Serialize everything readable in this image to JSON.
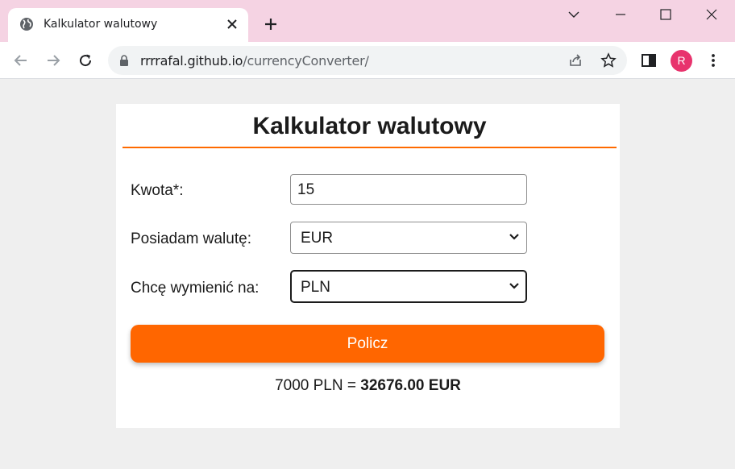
{
  "browser": {
    "tab_title": "Kalkulator walutowy",
    "url_host": "rrrrafal.github.io",
    "url_path": "/currencyConverter/",
    "profile_initial": "R",
    "accent_colors": {
      "titlebar": "#f5d3e3",
      "avatar": "#e8336d"
    }
  },
  "page": {
    "heading": "Kalkulator walutowy",
    "amount_label": "Kwota*:",
    "amount_value": "15",
    "have_label": "Posiadam walutę:",
    "have_value": "EUR",
    "want_label": "Chcę wymienić na:",
    "want_value": "PLN",
    "submit_label": "Policz",
    "result_prefix": "7000 PLN = ",
    "result_value": "32676.00 EUR",
    "accent_color": "#ff6600"
  }
}
